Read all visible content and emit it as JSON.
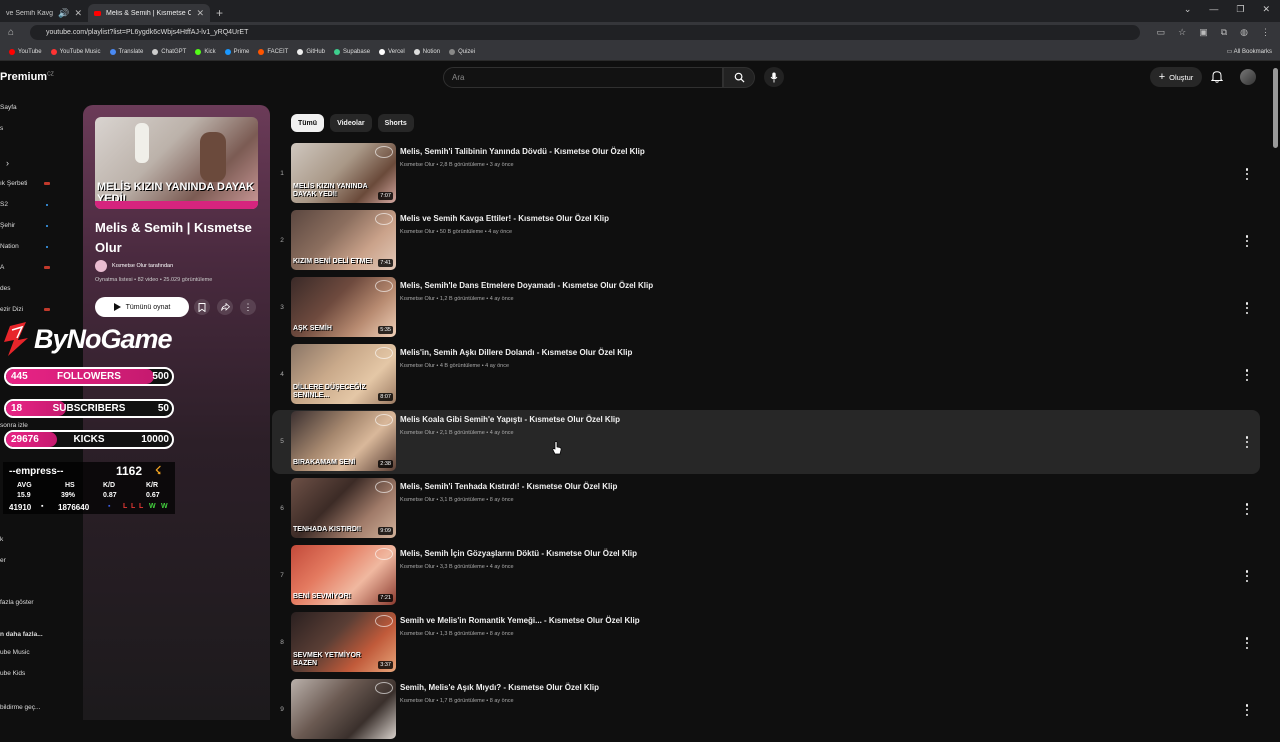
{
  "browser": {
    "tabs": [
      {
        "title": "ve Semih Kavga Ettiler",
        "active": false
      },
      {
        "title": "Melis & Semih | Kısmetse Olur",
        "active": true
      }
    ],
    "url": "youtube.com/playlist?list=PL6ygdk6cWbjs4HtffAJ-lv1_yRQ4UrET",
    "bookmarks": [
      "YouTube",
      "YouTube Music",
      "Translate",
      "ChatGPT",
      "Kick",
      "Prime",
      "FACEIT",
      "GitHub",
      "Supabase",
      "Vercel",
      "Notion",
      "Quizei"
    ],
    "all_bookmarks": "All Bookmarks"
  },
  "header": {
    "logo": "Premium",
    "logo_region": "CZ",
    "search_placeholder": "Ara",
    "create_label": "Oluştur"
  },
  "sidebar": {
    "items": [
      "Sayfa",
      "s",
      "ık Şerbeti",
      "S2",
      "Şehir",
      "Nation",
      "A",
      "des",
      "ezir Dizi",
      "sonra izle",
      "k",
      "er",
      "fazla göster",
      "n daha fazla...",
      "ube Music",
      "ube Kids",
      "bildirme geç..."
    ]
  },
  "playlist": {
    "thumb_caption": "MELİS KIZIN YANINDA DAYAK YEDİ!",
    "title": "Melis & Semih | Kısmetse Olur",
    "owner": "Kısmetse Olur tarafından",
    "meta": "Oynatma listesi • 82 video • 25.029 görüntüleme",
    "play_all": "Tümünü oynat"
  },
  "overlay": {
    "brand": "ByNoGame",
    "followers": {
      "current": "445",
      "label": "FOLLOWERS",
      "goal": "500",
      "progress": 0.89
    },
    "subscribers": {
      "current": "18",
      "label": "SUBSCRIBERS",
      "goal": "50",
      "progress": 0.36
    },
    "kicks": {
      "current": "29676",
      "label": "KICKS",
      "goal": "10000",
      "progress": 0.31
    },
    "stats": {
      "name": "--empress--",
      "elo": "1162",
      "headers": [
        "AVG",
        "HS",
        "K/D",
        "K/R"
      ],
      "values": [
        "15.9",
        "39%",
        "0.87",
        "0.67"
      ],
      "total1": "41910",
      "total2": "1876640",
      "results": [
        "L",
        "L",
        "L",
        "W",
        "W"
      ]
    }
  },
  "filters": [
    "Tümü",
    "Videolar",
    "Shorts"
  ],
  "videos": [
    {
      "index": "1",
      "title": "Melis, Semih'i Talibinin Yanında Dövdü - Kısmetse Olur Özel Klip",
      "meta": "Kısmetse Olur • 2,8 B görüntüleme • 3 ay önce",
      "duration": "7:07",
      "caption": "MELİS KIZIN YANINDA DAYAK YEDİ!"
    },
    {
      "index": "2",
      "title": "Melis ve Semih Kavga Ettiler! - Kısmetse Olur Özel Klip",
      "meta": "Kısmetse Olur • 50 B görüntüleme • 4 ay önce",
      "duration": "7:41",
      "caption": "KIZIM BENİ DELİ ETME!"
    },
    {
      "index": "3",
      "title": "Melis, Semih'le Dans Etmelere Doyamadı - Kısmetse Olur Özel Klip",
      "meta": "Kısmetse Olur • 1,2 B görüntüleme • 4 ay önce",
      "duration": "5:35",
      "caption": "AŞK SEMİH"
    },
    {
      "index": "4",
      "title": "Melis'in, Semih Aşkı Dillere Dolandı - Kısmetse Olur Özel Klip",
      "meta": "Kısmetse Olur • 4 B görüntüleme • 4 ay önce",
      "duration": "8:07",
      "caption": "DİLLERE DÜŞECEĞİZ SENİNLE..."
    },
    {
      "index": "5",
      "title": "Melis Koala Gibi Semih'e Yapıştı - Kısmetse Olur Özel Klip",
      "meta": "Kısmetse Olur • 2,1 B görüntüleme • 4 ay önce",
      "duration": "2:38",
      "caption": "BIRAKAMAM SENİ"
    },
    {
      "index": "6",
      "title": "Melis, Semih'i Tenhada Kıstırdı! - Kısmetse Olur Özel Klip",
      "meta": "Kısmetse Olur • 3,1 B görüntüleme • 8 ay önce",
      "duration": "9:09",
      "caption": "TENHADA KISTIRDI!"
    },
    {
      "index": "7",
      "title": "Melis, Semih İçin Gözyaşlarını Döktü - Kısmetse Olur Özel Klip",
      "meta": "Kısmetse Olur • 3,3 B görüntüleme • 4 ay önce",
      "duration": "7:21",
      "caption": "BENİ SEVMİYOR!"
    },
    {
      "index": "8",
      "title": "Semih ve Melis'in Romantik Yemeği... - Kısmetse Olur Özel Klip",
      "meta": "Kısmetse Olur • 1,3 B görüntüleme • 8 ay önce",
      "duration": "3:37",
      "caption": "SEVMEK YETMİYOR BAZEN"
    },
    {
      "index": "9",
      "title": "Semih, Melis'e Aşık Mıydı? - Kısmetse Olur Özel Klip",
      "meta": "Kısmetse Olur • 1,7 B görüntüleme • 8 ay önce",
      "duration": "",
      "caption": ""
    }
  ]
}
